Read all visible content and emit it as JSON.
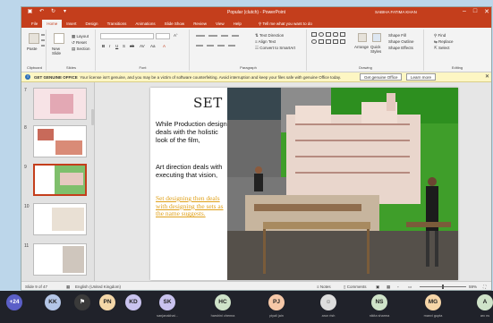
{
  "titlebar": {
    "title": "Popular (clutch) - PowerPoint",
    "user": "SABIHA FATIMA KHAN",
    "save_icon": "save-icon",
    "undo_icon": "undo-icon",
    "redo_icon": "redo-icon"
  },
  "tabs": [
    "File",
    "Home",
    "Insert",
    "Design",
    "Transitions",
    "Animations",
    "Slide Show",
    "Review",
    "View",
    "Help"
  ],
  "active_tab": "Home",
  "tell_me": "Tell me what you want to do",
  "ribbon": {
    "clipboard": {
      "label": "Clipboard",
      "paste": "Paste"
    },
    "slides": {
      "label": "Slides",
      "new_slide": "New Slide",
      "layout": "Layout",
      "reset": "Reset",
      "section": "Section"
    },
    "font": {
      "label": "Font"
    },
    "paragraph": {
      "label": "Paragraph",
      "text_direction": "Text Direction",
      "align_text": "Align Text",
      "convert": "Convert to SmartArt"
    },
    "drawing": {
      "label": "Drawing",
      "arrange": "Arrange",
      "quick_styles": "Quick Styles",
      "shape_fill": "Shape Fill",
      "shape_outline": "Shape Outline",
      "shape_effects": "Shape Effects"
    },
    "editing": {
      "label": "Editing",
      "find": "Find",
      "replace": "Replace",
      "select": "Select"
    }
  },
  "license_bar": {
    "title": "GET GENUINE OFFICE",
    "message": "Your license isn't genuine, and you may be a victim of software counterfeiting. Avoid interruption and keep your files safe with genuine Office today.",
    "button_primary": "Get genuine Office",
    "button_secondary": "Learn more"
  },
  "thumbnails": [
    {
      "num": "7"
    },
    {
      "num": "8"
    },
    {
      "num": "9"
    },
    {
      "num": "10"
    },
    {
      "num": "11"
    }
  ],
  "slide": {
    "title": "SET DESIGN",
    "para1": "While Production design deals with the holistic look of the film,",
    "para2": "Art direction deals with executing that vision,",
    "para3": "Set designing then deals with designing the sets as the name suggests."
  },
  "status": {
    "slide_of": "Slide 9 of 47",
    "language": "English (United Kingdom)",
    "notes": "Notes",
    "comments": "Comments",
    "zoom": "59%"
  },
  "meeting": {
    "participants": [
      {
        "initials": "+24",
        "name": "",
        "color": "#5b5fc7"
      },
      {
        "initials": "KK",
        "name": "",
        "color": "#b4c6e7"
      },
      {
        "initials": "",
        "name": "",
        "color": "#3a3a3a"
      },
      {
        "initials": "PN",
        "name": "",
        "color": "#f4d7a8"
      },
      {
        "initials": "KD",
        "name": "",
        "color": "#c9c3ef"
      },
      {
        "initials": "SK",
        "name": "sanjanakhat...",
        "color": "#c9c3ef"
      },
      {
        "initials": "HC",
        "name": "harshini chenna",
        "color": "#cfe3c9"
      },
      {
        "initials": "PJ",
        "name": "piyali jain",
        "color": "#f6c8a8"
      },
      {
        "initials": "",
        "name": "arun rish",
        "color": "#dddddd"
      },
      {
        "initials": "NS",
        "name": "nikita sharma",
        "color": "#cfe3c9"
      },
      {
        "initials": "MG",
        "name": "manvi gupta",
        "color": "#f6d6a8"
      },
      {
        "initials": "A",
        "name": "arc ns",
        "color": "#cfe3c9"
      }
    ]
  },
  "colors": {
    "accent": "#c43e1c",
    "link_gold": "#e0a11b"
  }
}
